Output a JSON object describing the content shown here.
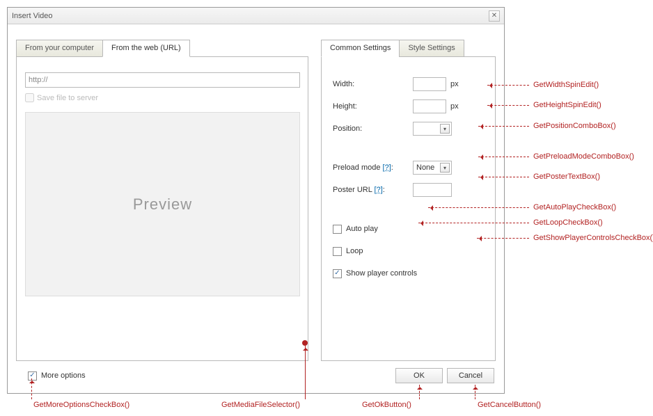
{
  "dialog": {
    "title": "Insert Video",
    "close": "✕"
  },
  "left": {
    "tabs": [
      "From your computer",
      "From the web (URL)"
    ],
    "activeTab": 1,
    "urlValue": "http://",
    "saveFileLabel": "Save file to server",
    "previewLabel": "Preview"
  },
  "right": {
    "tabs": [
      "Common Settings",
      "Style Settings"
    ],
    "activeTab": 0,
    "widthLabel": "Width:",
    "heightLabel": "Height:",
    "positionLabel": "Position:",
    "unitPx": "px",
    "preloadLabel": "Preload mode ",
    "preloadHelp": "[?]",
    "preloadValue": "None",
    "posterLabel": "Poster URL ",
    "posterHelp": "[?]",
    "autoplayLabel": "Auto play",
    "loopLabel": "Loop",
    "showControlsLabel": "Show player controls",
    "autoplayChecked": false,
    "loopChecked": false,
    "showControlsChecked": true
  },
  "footer": {
    "moreOptionsLabel": "More options",
    "moreOptionsChecked": true,
    "okLabel": "OK",
    "cancelLabel": "Cancel"
  },
  "annotations": {
    "width": "GetWidthSpinEdit()",
    "height": "GetHeightSpinEdit()",
    "position": "GetPositionComboBox()",
    "preload": "GetPreloadModeComboBox()",
    "poster": "GetPosterTextBox()",
    "autoplay": "GetAutoPlayCheckBox()",
    "loop": "GetLoopCheckBox()",
    "showctrl": "GetShowPlayerControlsCheckBox()",
    "moreopts": "GetMoreOptionsCheckBox()",
    "media": "GetMediaFileSelector()",
    "ok": "GetOkButton()",
    "cancel": "GetCancelButton()"
  }
}
